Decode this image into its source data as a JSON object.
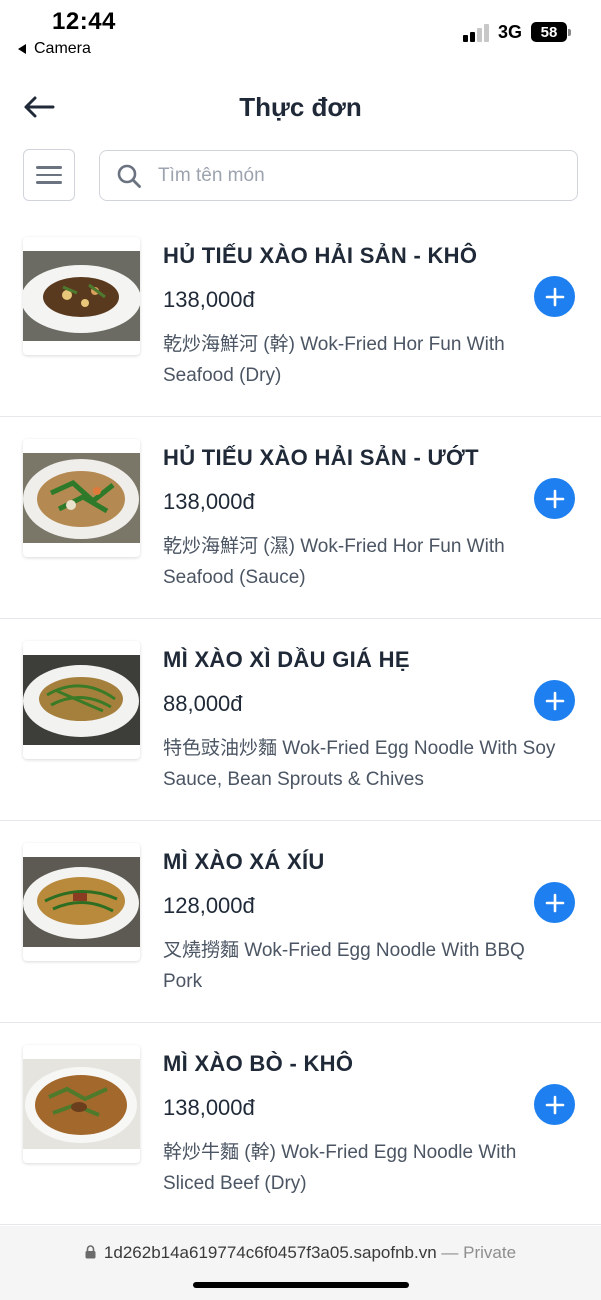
{
  "status_bar": {
    "time": "12:44",
    "back_app": "Camera",
    "network": "3G",
    "battery": "58"
  },
  "header": {
    "title": "Thực đơn",
    "back_icon": "arrow-left-icon"
  },
  "search": {
    "placeholder": "Tìm tên món",
    "value": ""
  },
  "items": [
    {
      "name": "HỦ TIẾU XÀO HẢI SẢN - KHÔ",
      "price": "138,000đ",
      "desc": "乾炒海鮮河 (幹) Wok-Fried Hor Fun With Seafood (Dry)"
    },
    {
      "name": "HỦ TIẾU XÀO HẢI SẢN - ƯỚT",
      "price": "138,000đ",
      "desc": "乾炒海鮮河 (濕) Wok-Fried Hor Fun With Seafood (Sauce)"
    },
    {
      "name": "MÌ XÀO XÌ DẦU GIÁ HẸ",
      "price": "88,000đ",
      "desc": "特色豉油炒麵 Wok-Fried Egg Noodle With Soy Sauce, Bean Sprouts & Chives"
    },
    {
      "name": "MÌ XÀO XÁ XÍU",
      "price": "128,000đ",
      "desc": "叉燒撈麵 Wok-Fried Egg Noodle With BBQ Pork"
    },
    {
      "name": "MÌ XÀO BÒ - KHÔ",
      "price": "138,000đ",
      "desc": "幹炒牛麵 (幹) Wok-Fried Egg Noodle With Sliced Beef (Dry)"
    }
  ],
  "url_bar": {
    "url": "1d262b14a619774c6f0457f3a05.sapofnb.vn",
    "suffix": "— Private"
  },
  "colors": {
    "accent": "#1d7ff0",
    "border": "#d1d5db"
  }
}
